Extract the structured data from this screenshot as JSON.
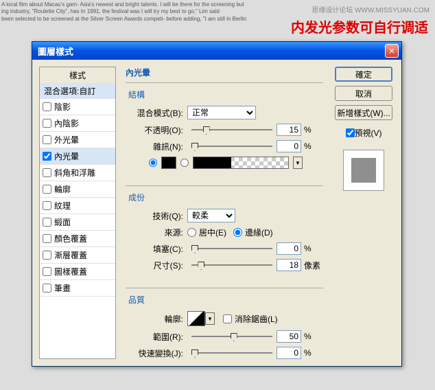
{
  "watermark": "思缘设计论坛  WWW.MISSYUAN.COM",
  "note": "内发光参数可自行调适",
  "dialog": {
    "title": "圖層樣式",
    "styles_header": "樣式",
    "styles_subheader": "混合選項:自訂",
    "styles": [
      {
        "label": "陰影",
        "checked": false,
        "active": false
      },
      {
        "label": "內陰影",
        "checked": false,
        "active": false
      },
      {
        "label": "外光暈",
        "checked": false,
        "active": false
      },
      {
        "label": "內光暈",
        "checked": true,
        "active": true
      },
      {
        "label": "斜角和浮雕",
        "checked": false,
        "active": false
      },
      {
        "label": "輪廓",
        "checked": false,
        "active": false
      },
      {
        "label": "紋理",
        "checked": false,
        "active": false
      },
      {
        "label": "緞面",
        "checked": false,
        "active": false
      },
      {
        "label": "顏色覆蓋",
        "checked": false,
        "active": false
      },
      {
        "label": "漸層覆蓋",
        "checked": false,
        "active": false
      },
      {
        "label": "圖樣覆蓋",
        "checked": false,
        "active": false
      },
      {
        "label": "筆畫",
        "checked": false,
        "active": false
      }
    ],
    "section_title": "內光暈",
    "structure": {
      "label": "結構",
      "blend_mode_label": "混合模式(B):",
      "blend_mode_value": "正常",
      "opacity_label": "不透明(O):",
      "opacity_value": "15",
      "noise_label": "雜訊(N):",
      "noise_value": "0",
      "pct": "%"
    },
    "elements": {
      "label": "成份",
      "technique_label": "技術(Q):",
      "technique_value": "較柔",
      "source_label": "來源:",
      "source_center": "居中(E)",
      "source_edge": "邊緣(D)",
      "choke_label": "填塞(C):",
      "choke_value": "0",
      "size_label": "尺寸(S):",
      "size_value": "18",
      "pct": "%",
      "px": "像素"
    },
    "quality": {
      "label": "品質",
      "contour_label": "輪廓:",
      "antialias_label": "消除鋸齒(L)",
      "range_label": "範圍(R):",
      "range_value": "50",
      "jitter_label": "快速變換(J):",
      "jitter_value": "0",
      "pct": "%"
    },
    "buttons": {
      "ok": "確定",
      "cancel": "取消",
      "new_style": "新增樣式(W)...",
      "preview": "預視(V)"
    }
  }
}
